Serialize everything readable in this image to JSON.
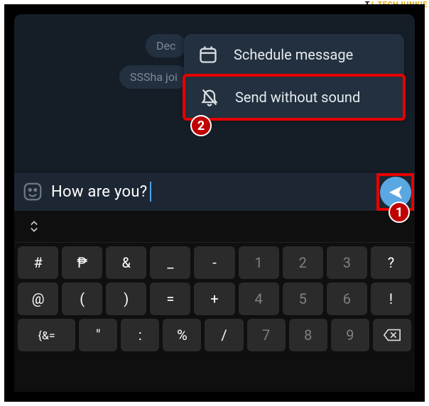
{
  "logo": {
    "t": "T",
    "j": "J",
    "name": "TECHJUNKIE"
  },
  "chat": {
    "chip1": "Dec",
    "chip2": "SSSha joi"
  },
  "menu": {
    "schedule": "Schedule message",
    "nosound": "Send without sound"
  },
  "input": {
    "text": "How are you?"
  },
  "badges": {
    "one": "1",
    "two": "2"
  },
  "keyboard": {
    "row1": [
      "#",
      "₱",
      "&",
      "_",
      "-",
      "1",
      "2",
      "3",
      "?"
    ],
    "row2": [
      "@",
      "(",
      ")",
      "=",
      "+",
      "4",
      "5",
      "6",
      "!"
    ],
    "row3": [
      "{&=",
      "\"",
      ":",
      "%",
      "/",
      "7",
      "8",
      "9",
      "⌫"
    ]
  }
}
